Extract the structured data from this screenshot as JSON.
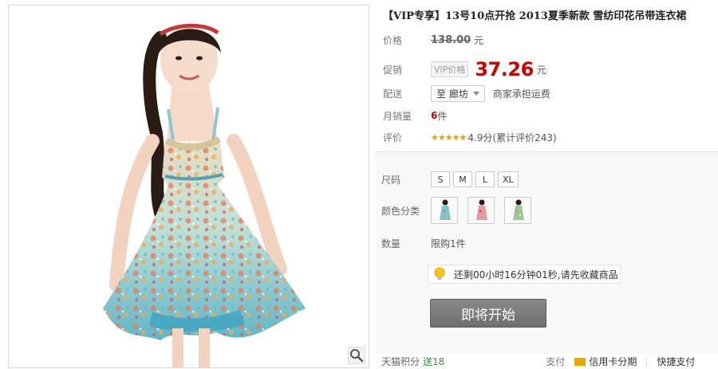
{
  "product": {
    "title": "【VIP专享】13号10点开抢 2013夏季新款 雪纺印花吊带连衣裙"
  },
  "price": {
    "label": "价格",
    "original": "138.00",
    "currency": "元"
  },
  "promo": {
    "label": "促销",
    "vip_tag": "VIP价格",
    "price": "37.26",
    "currency": "元"
  },
  "shipping": {
    "label": "配送",
    "destination": "至 廊坊",
    "note": "商家承担运费"
  },
  "sales": {
    "label": "月销量",
    "count": "6",
    "unit": "件"
  },
  "rating": {
    "label": "评价",
    "stars": "★★★★★",
    "text": "4.9分(累计评价243)"
  },
  "size": {
    "label": "尺码",
    "options": [
      "S",
      "M",
      "L",
      "XL"
    ]
  },
  "color": {
    "label": "颜色分类",
    "swatches": [
      "blue-floral",
      "pink-floral",
      "green-floral"
    ]
  },
  "quantity": {
    "label": "数量",
    "limit": "限购1件"
  },
  "countdown": {
    "icon": "lightbulb-icon",
    "text": "还剩00小时16分钟01秒,请先收藏商品"
  },
  "buy_button": {
    "label": "即将开始"
  },
  "footer": {
    "points_label": "天猫积分",
    "points_value": "送18",
    "pay_label": "支付",
    "credit": "信用卡分期",
    "express": "快捷支付"
  },
  "colors": {
    "accent_red": "#c40000",
    "star_gold": "#f0a000",
    "button_grey": "#777777"
  }
}
